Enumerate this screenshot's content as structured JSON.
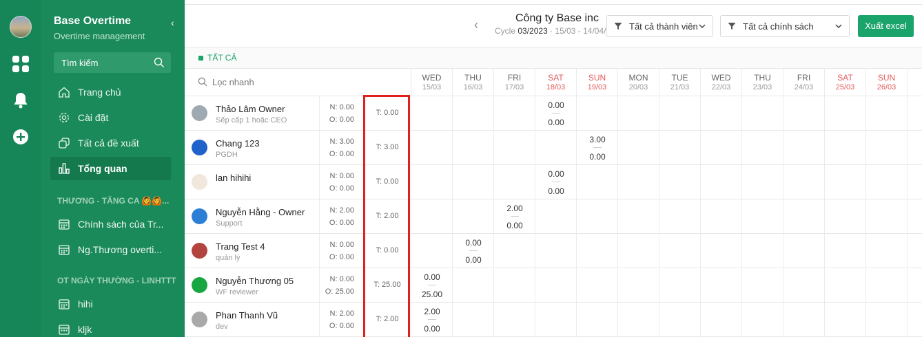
{
  "sidebar": {
    "title": "Base Overtime",
    "subtitle": "Overtime management",
    "collapse": "‹",
    "search_label": "Tìm kiếm",
    "items": [
      {
        "label": "Trang chủ",
        "icon": "home-icon"
      },
      {
        "label": "Cài đặt",
        "icon": "gear-icon"
      },
      {
        "label": "Tất cả đề xuất",
        "icon": "copy-icon"
      },
      {
        "label": "Tổng quan",
        "icon": "chart-bars-icon",
        "active": true
      }
    ],
    "section1": "THƯƠNG - TĂNG CA 🙆🙆...",
    "section1_items": [
      "Chính sách của Tr...",
      "Ng.Thương overti..."
    ],
    "section2": "OT NGÀY THƯỜNG - LINHTTT",
    "section2_items": [
      "hihi",
      "kljk"
    ]
  },
  "header": {
    "prev": "‹",
    "company": "Công ty Base inc",
    "cycle_label": "Cycle",
    "cycle_value": "03/2023",
    "cycle_range": "· 15/03 - 14/04/",
    "member_filter": "Tất cả thành viên",
    "policy_filter": "Tất cả chính sách",
    "export": "Xuất excel"
  },
  "filter_tag": "TẤT CẢ",
  "quick_search_placeholder": "Lọc nhanh",
  "days": [
    {
      "name": "WED",
      "date": "15/03",
      "weekend": false
    },
    {
      "name": "THU",
      "date": "16/03",
      "weekend": false
    },
    {
      "name": "FRI",
      "date": "17/03",
      "weekend": false
    },
    {
      "name": "SAT",
      "date": "18/03",
      "weekend": true
    },
    {
      "name": "SUN",
      "date": "19/03",
      "weekend": true
    },
    {
      "name": "MON",
      "date": "20/03",
      "weekend": false
    },
    {
      "name": "TUE",
      "date": "21/03",
      "weekend": false
    },
    {
      "name": "WED",
      "date": "22/03",
      "weekend": false
    },
    {
      "name": "THU",
      "date": "23/03",
      "weekend": false
    },
    {
      "name": "FRI",
      "date": "24/03",
      "weekend": false
    },
    {
      "name": "SAT",
      "date": "25/03",
      "weekend": true
    },
    {
      "name": "SUN",
      "date": "26/03",
      "weekend": true
    }
  ],
  "rows": [
    {
      "name": "Thảo Lâm Owner",
      "position": "Sếp cấp 1 hoặc CEO",
      "n": "N: 0.00",
      "o": "O: 0.00",
      "t": "T: 0.00",
      "avatar": "#9fa9b1",
      "cells": [
        {
          "day": 3,
          "a": "0.00",
          "b": "0.00"
        }
      ]
    },
    {
      "name": "Chang 123",
      "position": "PGDH",
      "n": "N: 3.00",
      "o": "O: 0.00",
      "t": "T: 3.00",
      "avatar": "#1f62c9",
      "cells": [
        {
          "day": 4,
          "a": "3.00",
          "b": "0.00"
        }
      ]
    },
    {
      "name": "lan hihihi",
      "position": "",
      "n": "N: 0.00",
      "o": "O: 0.00",
      "t": "T: 0.00",
      "avatar": "#f1e7dc",
      "cells": [
        {
          "day": 3,
          "a": "0.00",
          "b": "0.00"
        }
      ]
    },
    {
      "name": "Nguyễn Hằng - Owner",
      "position": "Support",
      "n": "N: 2.00",
      "o": "O: 0.00",
      "t": "T: 2.00",
      "avatar": "#2d7fd6",
      "cells": [
        {
          "day": 2,
          "a": "2.00",
          "b": "0.00"
        }
      ]
    },
    {
      "name": "Trang Test 4",
      "position": "quản lý",
      "n": "N: 0.00",
      "o": "O: 0.00",
      "t": "T: 0.00",
      "avatar": "#b3433f",
      "cells": [
        {
          "day": 1,
          "a": "0.00",
          "b": "0.00"
        }
      ]
    },
    {
      "name": "Nguyễn Thương 05",
      "position": "WF reviewer",
      "n": "N: 0.00",
      "o": "O: 25.00",
      "t": "T: 25.00",
      "avatar": "#18a642",
      "cells": [
        {
          "day": 0,
          "a": "0.00",
          "b": "25.00"
        }
      ]
    },
    {
      "name": "Phan Thanh Vũ",
      "position": "dev",
      "n": "N: 2.00",
      "o": "O: 0.00",
      "t": "T: 2.00",
      "avatar": "#a9a9a9",
      "cells": [
        {
          "day": 0,
          "a": "2.00",
          "b": "0.00"
        }
      ]
    }
  ]
}
